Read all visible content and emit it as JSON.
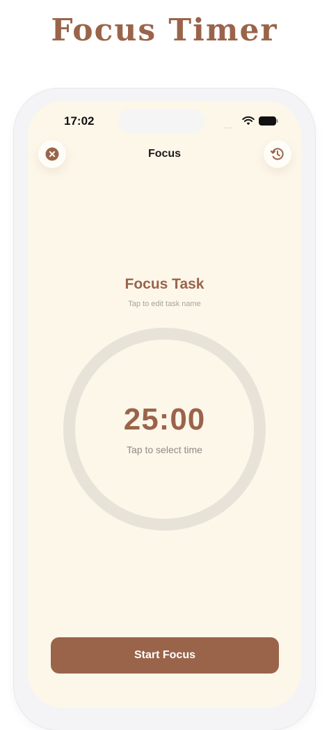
{
  "header": {
    "title": "Focus Timer"
  },
  "status_bar": {
    "time": "17:02",
    "signal": "....",
    "icons": [
      "wifi-icon",
      "battery-icon"
    ]
  },
  "nav": {
    "title": "Focus",
    "close_icon": "close-icon",
    "history_icon": "history-icon"
  },
  "task": {
    "name": "Focus Task",
    "hint": "Tap to edit task name"
  },
  "timer": {
    "value": "25:00",
    "hint": "Tap to select time",
    "progress": 0
  },
  "actions": {
    "start_label": "Start Focus"
  },
  "colors": {
    "accent": "#9a644a",
    "background": "#fdf7ea",
    "ring": "#e8e3d9",
    "frame": "#f4f3f5"
  }
}
